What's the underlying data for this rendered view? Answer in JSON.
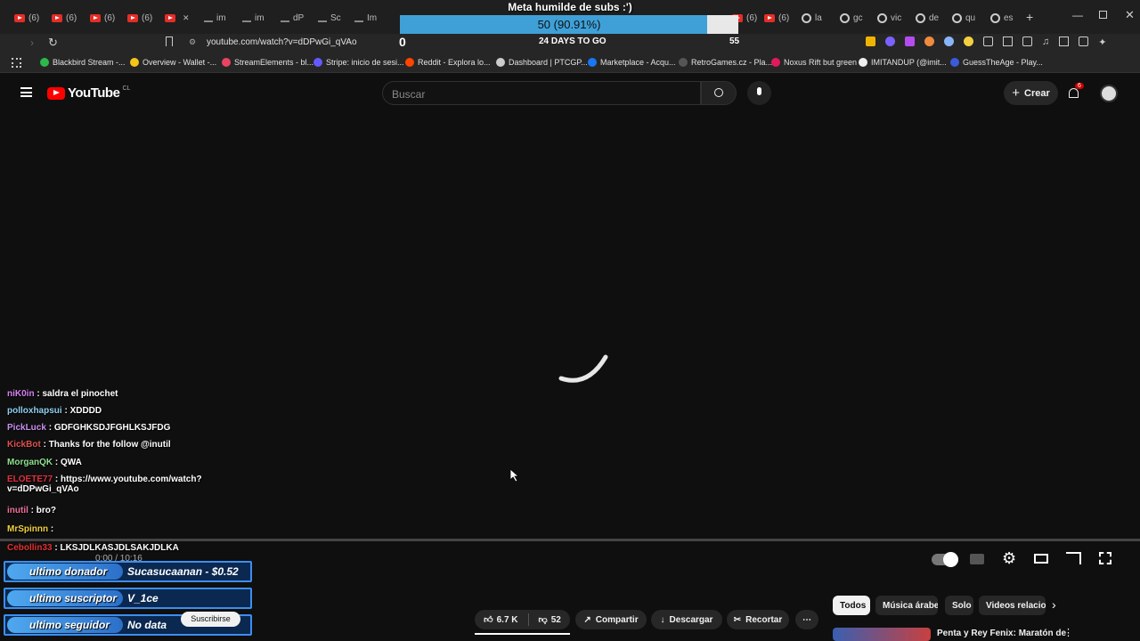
{
  "browser": {
    "tabs": [
      "(6)",
      "(6)",
      "(6)",
      "(6)",
      "",
      "im",
      "im",
      "dP",
      "Sc",
      "Im",
      "(6)",
      "(6)",
      "la",
      "gc",
      "vic",
      "de",
      "qu",
      "es"
    ],
    "url": "youtube.com/watch?v=dDPwGi_qVAo",
    "bookmarks": [
      {
        "label": "Blackbird Stream -...",
        "color": "#2db84c"
      },
      {
        "label": "Overview - Wallet -...",
        "color": "#f5c518"
      },
      {
        "label": "StreamElements - bl...",
        "color": "#e94560"
      },
      {
        "label": "Stripe: inicio de sesi...",
        "color": "#635bff"
      },
      {
        "label": "Reddit - Explora lo...",
        "color": "#ff4500"
      },
      {
        "label": "Dashboard | PTCGP...",
        "color": "#cccccc"
      },
      {
        "label": "Marketplace - Acqu...",
        "color": "#1877f2"
      },
      {
        "label": "RetroGames.cz - Pla...",
        "color": "#555555"
      },
      {
        "label": "Noxus Rift but green",
        "color": "#e3195c"
      },
      {
        "label": "IMITANDUP (@imit...",
        "color": "#eeeeee"
      },
      {
        "label": "GuessTheAge - Play...",
        "color": "#3b5bdb"
      }
    ]
  },
  "goal": {
    "title": "Meta humilde de subs :')",
    "text": "50 (90.91%)",
    "progress": 0.9091,
    "left_value": "0",
    "countdown": "24 DAYS TO GO",
    "right_value": "55"
  },
  "youtube": {
    "logo": "YouTube",
    "region": "CL",
    "search_placeholder": "Buscar",
    "create_label": "Crear",
    "notif_count": "6"
  },
  "chat": [
    {
      "user": "niK0in",
      "color": "#d880f0",
      "msg": "saldra el pinochet"
    },
    {
      "user": "polloxhapsui",
      "color": "#8fd0f0",
      "msg": "XDDDD"
    },
    {
      "user": "PickLuck",
      "color": "#c890f0",
      "msg": "GDFGHKSDJFGHLKSJFDG"
    },
    {
      "user": "KickBot",
      "color": "#e05050",
      "msg": "Thanks for the follow @inutil"
    },
    {
      "user": "MorganQK",
      "color": "#90e090",
      "msg": "QWA"
    },
    {
      "user": "ELOETE77",
      "color": "#e03040",
      "msg": "https://www.youtube.com/watch?",
      "msg2": "v=dDPwGi_qVAo"
    },
    {
      "user": "inutil",
      "color": "#f070a0",
      "msg": "bro?"
    },
    {
      "user": "MrSpinnn",
      "color": "#f0d040",
      "msg": ""
    },
    {
      "user": "Cebollin33",
      "color": "#e03030",
      "msg": "LKSJDLKASJDLSAKJDLKA"
    }
  ],
  "alerts": [
    {
      "label": "ultimo donador",
      "value": "Sucasucaanan - $0.52"
    },
    {
      "label": "ultimo suscriptor",
      "value": "V_1ce"
    },
    {
      "label": "ultimo seguidor",
      "value": "No data"
    }
  ],
  "player": {
    "time": "0:00 / 10:16"
  },
  "actions": {
    "likes": "6.7 K",
    "dislikes": "52",
    "share": "Compartir",
    "download": "Descargar",
    "clip": "Recortar",
    "subscribe": "Suscribirse"
  },
  "chips": [
    "Todos",
    "Música árabe",
    "Solo",
    "Videos relacio"
  ],
  "related": {
    "title": "Penta y Rey Fenix: Maratón de"
  }
}
